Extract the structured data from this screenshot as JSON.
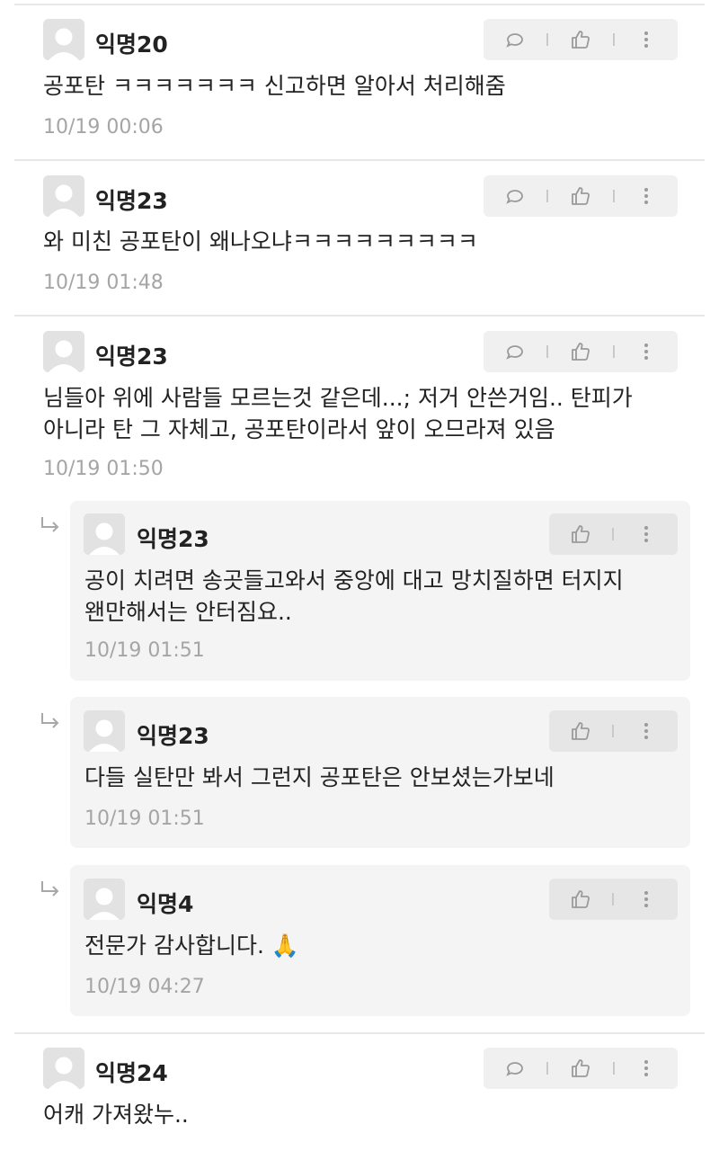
{
  "comments": [
    {
      "author": "익명20",
      "lines": [
        "공포탄 ㅋㅋㅋㅋㅋㅋㅋ 신고하면 알아서 처리해줌"
      ],
      "time": "10/19 00:06",
      "reply": false
    },
    {
      "author": "익명23",
      "lines": [
        "와 미친 공포탄이 왜나오냐ㅋㅋㅋㅋㅋㅋㅋㅋㅋ"
      ],
      "time": "10/19 01:48",
      "reply": false
    },
    {
      "author": "익명23",
      "lines": [
        "님들아 위에 사람들 모르는것 같은데...; 저거 안쓴거임.. 탄피가",
        "아니라 탄 그 자체고, 공포탄이라서 앞이 오므라져 있음"
      ],
      "time": "10/19 01:50",
      "reply": false
    },
    {
      "author": "익명23",
      "lines": [
        "공이 치려면 송곳들고와서 중앙에 대고 망치질하면 터지지",
        "왠만해서는 안터짐요.."
      ],
      "time": "10/19 01:51",
      "reply": true
    },
    {
      "author": "익명23",
      "lines": [
        "다들 실탄만 봐서 그런지 공포탄은 안보셨는가보네"
      ],
      "time": "10/19 01:51",
      "reply": true
    },
    {
      "author": "익명4",
      "lines": [
        "전문가 감사합니다. 🙏"
      ],
      "time": "10/19 04:27",
      "reply": true
    },
    {
      "author": "익명24",
      "lines": [
        "어캐 가져왔누.."
      ],
      "time": "",
      "reply": false
    }
  ],
  "icons": {
    "comment": "speech-bubble-icon",
    "like": "thumbs-up-icon",
    "more": "vertical-dots-icon",
    "reply": "reply-arrow-icon",
    "avatar": "default-avatar-icon"
  },
  "colors": {
    "text": "#222222",
    "time": "#a5a5a5",
    "reply_bg": "#f4f4f4",
    "action_bg": "#f0f0f0",
    "icon": "#9a9a9a"
  }
}
